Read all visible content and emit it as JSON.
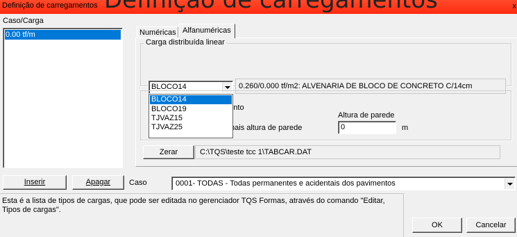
{
  "window": {
    "title": "Definição de carregamentos",
    "close_glyph": "x",
    "overlay_heading": "Definição de carregamentos"
  },
  "left_panel": {
    "label": "Caso/Carga",
    "items": [
      "0.00 tf/m"
    ]
  },
  "tabs": [
    {
      "label": "Numéricas"
    },
    {
      "label": "Alfanuméricas"
    }
  ],
  "group_carga": {
    "label": "Carga distribuída linear",
    "combo_value": "BLOCO14",
    "description": "0.260/0.000 tf/m2: ALVENARIA DE BLOCO DE CONCRETO C/14cm",
    "dropdown_options": [
      "BLOCO14",
      "BLOCO19",
      "TJVAZ15",
      "TJVAZ25"
    ]
  },
  "group_modo": {
    "partial_option_label": "mento",
    "option_label": "P/unidade de área mais altura de parede",
    "altura_label": "Altura de parede",
    "altura_value": "0",
    "unit": "m"
  },
  "zerar": {
    "button_label": "Zerar",
    "path": "C:\\TQS\\teste tcc 1\\TABCAR.DAT"
  },
  "bottom": {
    "inserir_label": "Inserir",
    "apagar_label": "Apagar",
    "caso_label": "Caso",
    "caso_value": "0001- TODAS - Todas permanentes e acidentais dos pavimentos",
    "help_text": "Esta é a lista de tipos de cargas, que pode ser editada no gerenciador TQS Formas, através do comando \"Editar, Tipos de cargas\".",
    "ok_label": "OK",
    "cancel_label": "Cancelar"
  }
}
